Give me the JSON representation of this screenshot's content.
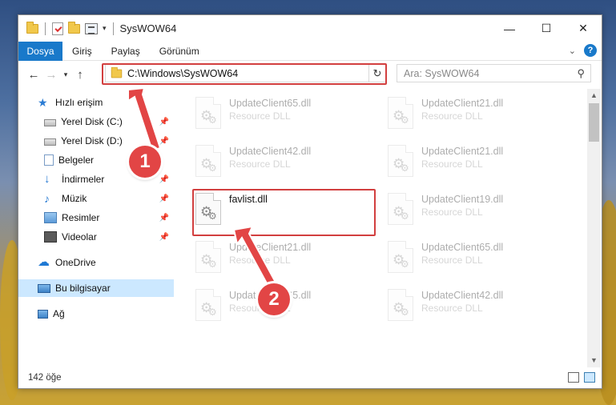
{
  "window": {
    "title": "SysWOW64",
    "controls": {
      "minimize": "—",
      "maximize": "☐",
      "close": "✕"
    }
  },
  "ribbon": {
    "file_tab": "Dosya",
    "tabs": [
      "Giriş",
      "Paylaş",
      "Görünüm"
    ],
    "help": "?"
  },
  "nav": {
    "address": "C:\\Windows\\SysWOW64",
    "search_placeholder": "Ara: SysWOW64"
  },
  "sidebar": {
    "items": [
      {
        "label": "Hızlı erişim",
        "icon": "star-icon"
      },
      {
        "label": "Yerel Disk (C:)",
        "icon": "disk-icon"
      },
      {
        "label": "Yerel Disk (D:)",
        "icon": "disk-icon"
      },
      {
        "label": "Belgeler",
        "icon": "documents-icon"
      },
      {
        "label": "İndirmeler",
        "icon": "download-icon"
      },
      {
        "label": "Müzik",
        "icon": "music-icon"
      },
      {
        "label": "Resimler",
        "icon": "pictures-icon"
      },
      {
        "label": "Videolar",
        "icon": "videos-icon"
      },
      {
        "label": "OneDrive",
        "icon": "cloud-icon"
      },
      {
        "label": "Bu bilgisayar",
        "icon": "computer-icon"
      },
      {
        "label": "Ağ",
        "icon": "network-icon"
      }
    ]
  },
  "files": [
    {
      "name": "UpdateClient65.dll",
      "type": "Resource DLL"
    },
    {
      "name": "UpdateClient21.dll",
      "type": "Resource DLL"
    },
    {
      "name": "UpdateClient42.dll",
      "type": "Resource DLL"
    },
    {
      "name": "UpdateClient21.dll",
      "type": "Resource DLL"
    },
    {
      "name": "favlist.dll",
      "type": ""
    },
    {
      "name": "UpdateClient19.dll",
      "type": "Resource DLL"
    },
    {
      "name": "UpdateClient21.dll",
      "type": "Resource DLL"
    },
    {
      "name": "UpdateClient65.dll",
      "type": "Resource DLL"
    },
    {
      "name": "UpdateClient65.dll",
      "type": "Resource DLL"
    },
    {
      "name": "UpdateClient42.dll",
      "type": "Resource DLL"
    }
  ],
  "status": {
    "item_count": "142 öğe"
  },
  "annotations": {
    "step1": "1",
    "step2": "2",
    "color": "#d23f3f"
  }
}
